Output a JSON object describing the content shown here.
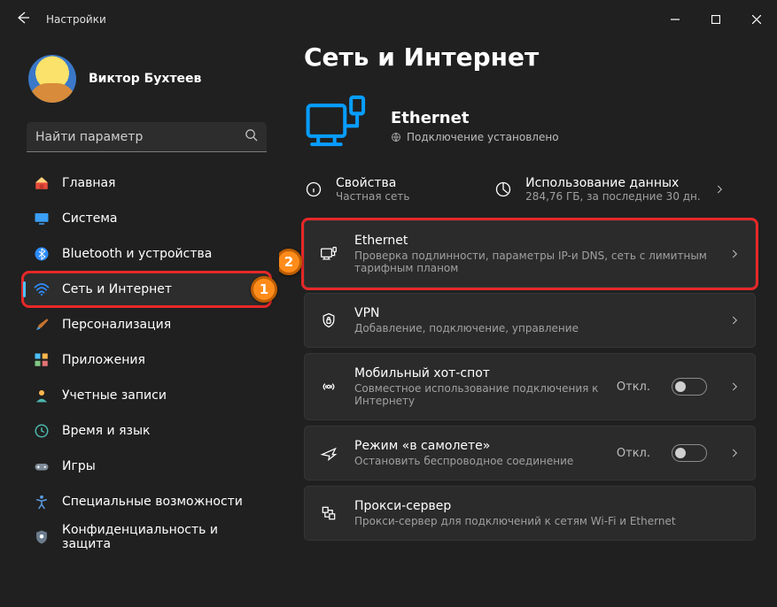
{
  "window": {
    "title": "Настройки"
  },
  "profile": {
    "name": "Виктор Бухтеев",
    "sub": ""
  },
  "search": {
    "placeholder": "Найти параметр"
  },
  "sidebar": {
    "items": [
      {
        "label": "Главная",
        "icon": "home"
      },
      {
        "label": "Система",
        "icon": "system"
      },
      {
        "label": "Bluetooth и устройства",
        "icon": "bluetooth"
      },
      {
        "label": "Сеть и Интернет",
        "icon": "wifi"
      },
      {
        "label": "Персонализация",
        "icon": "brush"
      },
      {
        "label": "Приложения",
        "icon": "apps"
      },
      {
        "label": "Учетные записи",
        "icon": "account"
      },
      {
        "label": "Время и язык",
        "icon": "time"
      },
      {
        "label": "Игры",
        "icon": "games"
      },
      {
        "label": "Специальные возможности",
        "icon": "accessibility"
      },
      {
        "label": "Конфиденциальность и защита",
        "icon": "privacy"
      }
    ]
  },
  "callouts": {
    "c1": "1",
    "c2": "2"
  },
  "page": {
    "title": "Сеть и Интернет",
    "hero": {
      "title": "Ethernet",
      "sub": "Подключение установлено"
    },
    "info": {
      "props_title": "Свойства",
      "props_sub": "Частная сеть",
      "usage_title": "Использование данных",
      "usage_sub": "284,76 ГБ, за последние 30 дн."
    },
    "cards": [
      {
        "title": "Ethernet",
        "sub": "Проверка подлинности, параметры IP-и DNS, сеть с лимитным тарифным планом"
      },
      {
        "title": "VPN",
        "sub": "Добавление, подключение, управление"
      },
      {
        "title": "Мобильный хот-спот",
        "sub": "Совместное использование подключения к Интернету",
        "state": "Откл."
      },
      {
        "title": "Режим «в самолете»",
        "sub": "Остановить беспроводное соединение",
        "state": "Откл."
      },
      {
        "title": "Прокси-сервер",
        "sub": "Прокси-сервер для подключений к сетям Wi-Fi и Ethernet"
      }
    ]
  }
}
